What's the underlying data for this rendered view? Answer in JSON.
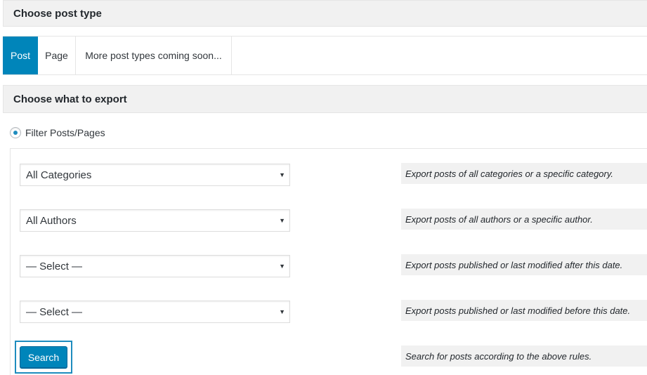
{
  "sections": {
    "post_type_title": "Choose post type",
    "export_title": "Choose what to export"
  },
  "tabs": [
    {
      "label": "Post",
      "active": true
    },
    {
      "label": "Page",
      "active": false
    },
    {
      "label": "More post types coming soon...",
      "active": false
    }
  ],
  "filter": {
    "radio_label": "Filter Posts/Pages",
    "selected": true
  },
  "fields": [
    {
      "value": "All Categories",
      "description": "Export posts of all categories or a specific category."
    },
    {
      "value": "All Authors",
      "description": "Export posts of all authors or a specific author."
    },
    {
      "value": "— Select —",
      "description": "Export posts published or last modified after this date."
    },
    {
      "value": "— Select —",
      "description": "Export posts published or last modified before this date."
    }
  ],
  "search": {
    "label": "Search",
    "description": "Search for posts according to the above rules."
  },
  "colors": {
    "accent": "#0085ba",
    "panel_bg": "#f1f1f1"
  }
}
